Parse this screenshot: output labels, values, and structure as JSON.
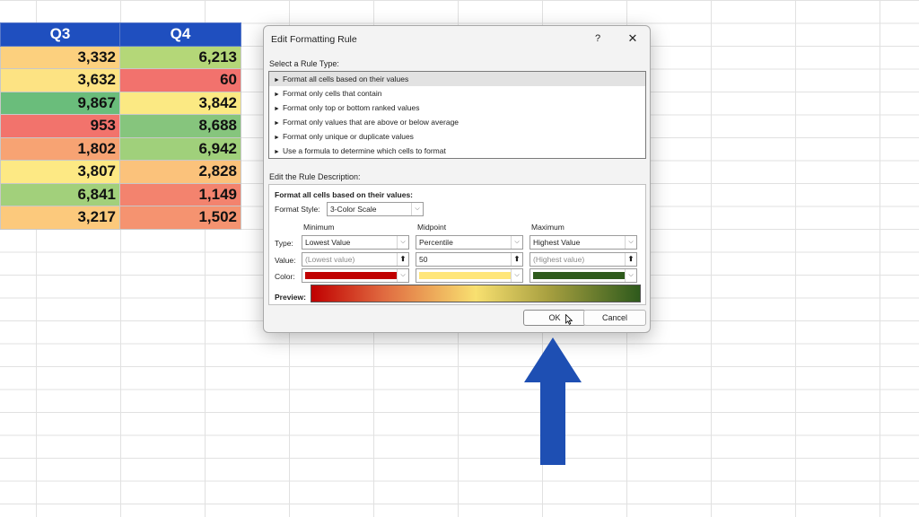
{
  "sheet": {
    "headers": [
      "Q3",
      "Q4"
    ],
    "rows": [
      [
        {
          "v": "3,332",
          "c": "#fcd07e"
        },
        {
          "v": "6,213",
          "c": "#b4d778"
        }
      ],
      [
        {
          "v": "3,632",
          "c": "#fde383"
        },
        {
          "v": "60",
          "c": "#f2726d"
        }
      ],
      [
        {
          "v": "9,867",
          "c": "#6abd7b"
        },
        {
          "v": "3,842",
          "c": "#fbe983"
        }
      ],
      [
        {
          "v": "953",
          "c": "#f2736c"
        },
        {
          "v": "8,688",
          "c": "#86c57d"
        }
      ],
      [
        {
          "v": "1,802",
          "c": "#f7a373"
        },
        {
          "v": "6,942",
          "c": "#a0d07b"
        }
      ],
      [
        {
          "v": "3,807",
          "c": "#fde984"
        },
        {
          "v": "2,828",
          "c": "#fbc27b"
        }
      ],
      [
        {
          "v": "6,841",
          "c": "#a2d07b"
        },
        {
          "v": "1,149",
          "c": "#f3836e"
        }
      ],
      [
        {
          "v": "3,217",
          "c": "#fcc97c"
        },
        {
          "v": "1,502",
          "c": "#f59370"
        }
      ]
    ]
  },
  "dialog": {
    "title": "Edit Formatting Rule",
    "help": "?",
    "close": "✕",
    "rule_type_label": "Select a Rule Type:",
    "rule_types": [
      "Format all cells based on their values",
      "Format only cells that contain",
      "Format only top or bottom ranked values",
      "Format only values that are above or below average",
      "Format only unique or duplicate values",
      "Use a formula to determine which cells to format"
    ],
    "selected_rule_index": 0,
    "description_label": "Edit the Rule Description:",
    "description_heading": "Format all cells based on their values:",
    "format_style_label": "Format Style:",
    "format_style_value": "3-Color Scale",
    "columns": {
      "minimum": "Minimum",
      "midpoint": "Midpoint",
      "maximum": "Maximum"
    },
    "row_labels": {
      "type": "Type:",
      "value": "Value:",
      "color": "Color:"
    },
    "min": {
      "type": "Lowest Value",
      "value_placeholder": "(Lowest value)",
      "color": "#c00000"
    },
    "mid": {
      "type": "Percentile",
      "value": "50",
      "color": "#ffe67a"
    },
    "max": {
      "type": "Highest Value",
      "value_placeholder": "(Highest value)",
      "color": "#2e5a1c"
    },
    "preview_label": "Preview:",
    "ok_label": "OK",
    "cancel_label": "Cancel"
  },
  "annotation": {
    "arrow_color": "#1e4fb3"
  }
}
